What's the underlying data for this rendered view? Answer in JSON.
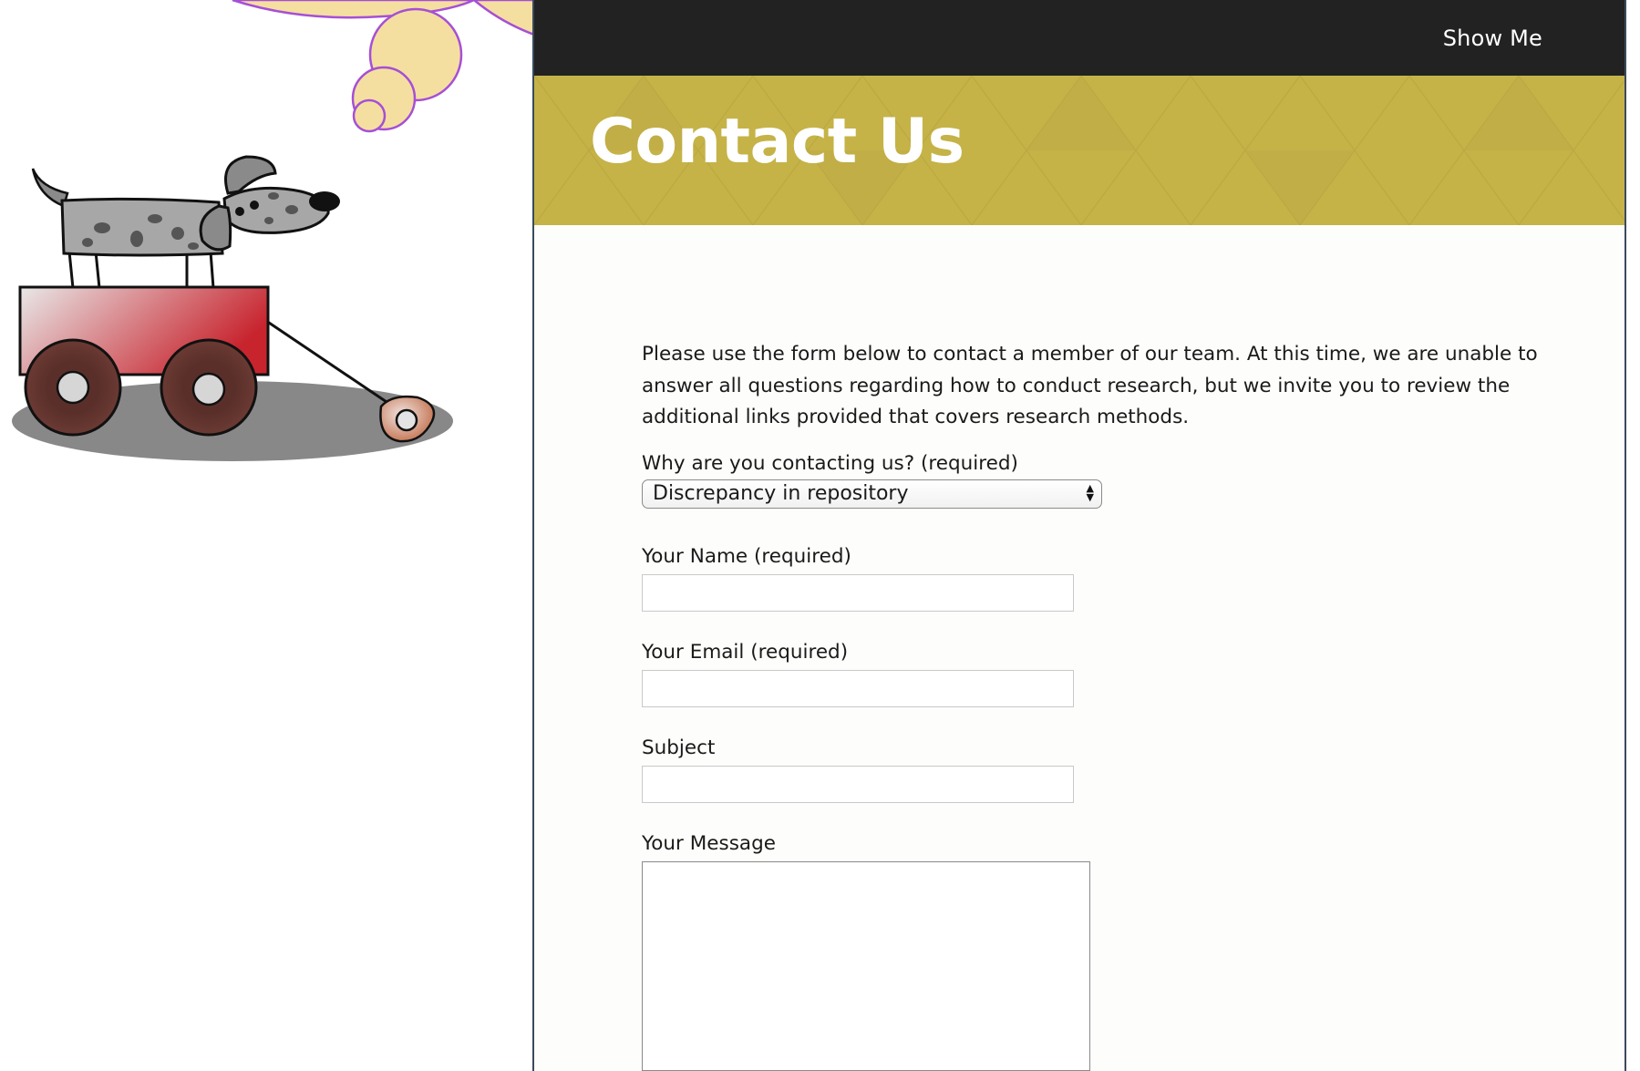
{
  "nav": {
    "show_me_label": "Show Me"
  },
  "banner": {
    "title": "Contact Us",
    "background_color": "#c5b348"
  },
  "intro_text": "Please use the form below to contact a member of our team. At this time, we are unable to answer all questions regarding how to conduct research, but we invite you to review the additional links provided that covers research methods.",
  "form": {
    "reason": {
      "label": "Why are you contacting us? (required)",
      "selected": "Discrepancy in repository"
    },
    "name": {
      "label": "Your Name (required)",
      "value": ""
    },
    "email": {
      "label": "Your Email (required)",
      "value": ""
    },
    "subject": {
      "label": "Subject",
      "value": ""
    },
    "message": {
      "label": "Your Message",
      "value": ""
    }
  },
  "colors": {
    "topbar": "#222222",
    "panel_border": "#3b4a5c",
    "cloud_fill": "#f5dfa0",
    "cloud_stroke": "#a64fd6",
    "wagon_red": "#c8242e"
  },
  "icons": {
    "select_arrows": "select-arrows-icon"
  }
}
